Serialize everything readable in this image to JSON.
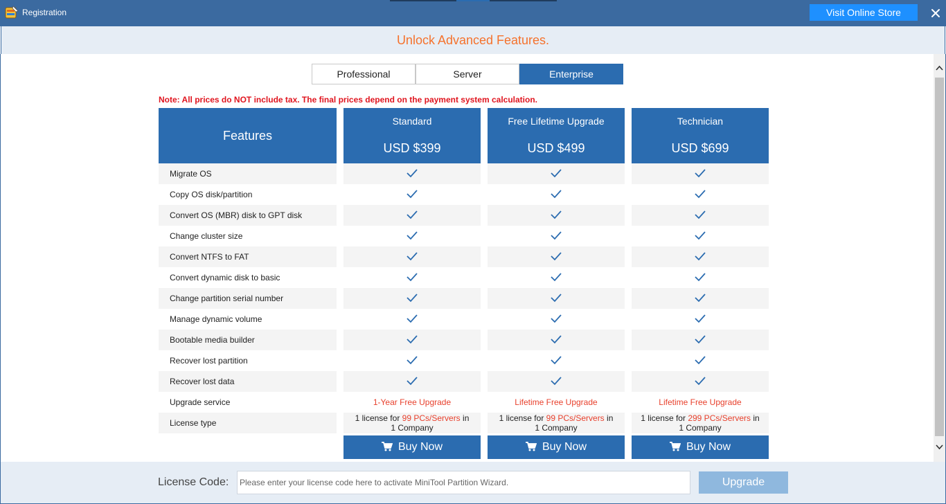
{
  "window": {
    "title": "Registration",
    "visit_store_label": "Visit Online Store"
  },
  "header": {
    "title": "Unlock Advanced Features."
  },
  "tabs": [
    {
      "label": "Professional",
      "active": false
    },
    {
      "label": "Server",
      "active": false
    },
    {
      "label": "Enterprise",
      "active": true
    }
  ],
  "note": "Note: All prices do NOT include tax. The final prices depend on the payment system calculation.",
  "table": {
    "features_header": "Features",
    "plans": [
      {
        "name": "Standard",
        "price": "USD $399",
        "upgrade": "1-Year Free Upgrade",
        "license_pre": "1 license for ",
        "license_hl": "99 PCs/Servers",
        "license_mid": " in",
        "license_post": "1 Company",
        "buy_label": "Buy Now"
      },
      {
        "name": "Free Lifetime Upgrade",
        "price": "USD $499",
        "upgrade": "Lifetime Free Upgrade",
        "license_pre": "1 license for ",
        "license_hl": "99 PCs/Servers",
        "license_mid": " in",
        "license_post": "1 Company",
        "buy_label": "Buy Now"
      },
      {
        "name": "Technician",
        "price": "USD $699",
        "upgrade": "Lifetime Free Upgrade",
        "license_pre": "1 license for ",
        "license_hl": "299 PCs/Servers",
        "license_mid": " in",
        "license_post": "1 Company",
        "buy_label": "Buy Now"
      }
    ],
    "features": [
      "Migrate OS",
      "Copy OS disk/partition",
      "Convert OS (MBR) disk to GPT disk",
      "Change cluster size",
      "Convert NTFS to FAT",
      "Convert dynamic disk to basic",
      "Change partition serial number",
      "Manage dynamic volume",
      "Bootable media builder",
      "Recover lost partition",
      "Recover lost data"
    ],
    "upgrade_row_label": "Upgrade service",
    "license_row_label": "License type"
  },
  "footer": {
    "license_label": "License Code:",
    "license_placeholder": "Please enter your license code here to activate MiniTool Partition Wizard.",
    "license_value": "",
    "upgrade_label": "Upgrade"
  },
  "colors": {
    "titlebar": "#3b6aa0",
    "accent_blue": "#2b6cb0",
    "store_button": "#1e90ff",
    "header_orange": "#f5722c",
    "note_red": "#e0141e",
    "highlight_red": "#e8412d",
    "row_gray": "#f4f4f4",
    "upgrade_button": "#8fb8de"
  }
}
